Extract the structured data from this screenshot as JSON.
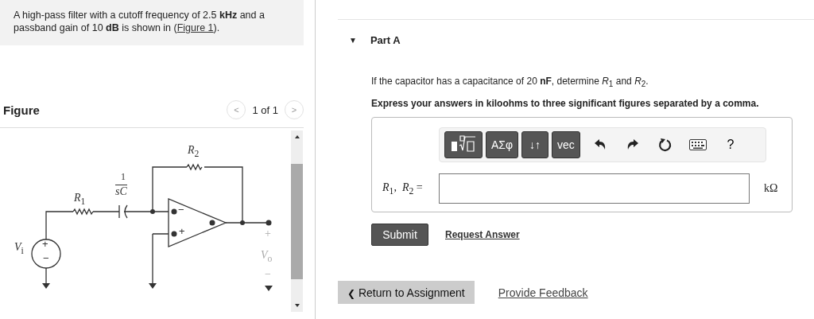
{
  "problem": {
    "text": "A high-pass filter with a cutoff frequency of 2.5 **kHz** and a passband gain of 10 **dB** is shown in (",
    "link": "Figure 1",
    "after": ")."
  },
  "figure": {
    "heading": "Figure",
    "pager": "1 of 1",
    "prev": "<",
    "next": ">",
    "labels": [
      {
        "kind": "r2",
        "text": "*R*$_{2}$"
      },
      {
        "kind": "r1",
        "text": "*R*$_{1}$"
      },
      {
        "kind": "cap_num",
        "text": "1"
      },
      {
        "kind": "cap_den",
        "text": "*sC*"
      },
      {
        "kind": "vi",
        "text": "*V*$_{i}$"
      },
      {
        "kind": "src_plus",
        "text": "+"
      },
      {
        "kind": "src_minus",
        "text": "−"
      },
      {
        "kind": "inv",
        "text": "−"
      },
      {
        "kind": "noninv",
        "text": "+"
      },
      {
        "kind": "vo_plus",
        "text": "+"
      },
      {
        "kind": "vo",
        "text": "*V*$_{o}$"
      },
      {
        "kind": "vo_minus",
        "text": "−"
      }
    ]
  },
  "part": {
    "toggle": "▼",
    "title": "Part A",
    "expanded": true,
    "question": "If the capacitor has a capacitance of 20 **nF**, determine *R*$_{1}$ and *R*$_{2}$.",
    "instruction": "Express your answers in kiloohms to three significant figures separated by a comma.",
    "toolbar": [
      {
        "kind": "template"
      },
      {
        "kind": "text",
        "label": "ΑΣφ"
      },
      {
        "kind": "text",
        "label": "↓↑"
      },
      {
        "kind": "text",
        "label": "vec"
      },
      {
        "kind": "undo"
      },
      {
        "kind": "redo"
      },
      {
        "kind": "reset"
      },
      {
        "kind": "keyboard"
      },
      {
        "kind": "help",
        "label": "?"
      }
    ],
    "answer_label": "*R*$_{1}$,  *R*$_{2}$ =",
    "unit": "kΩ",
    "submit": "Submit",
    "request": "Request Answer"
  },
  "footer": {
    "back_arrow": "❮",
    "back": "Return to Assignment",
    "feedback": "Provide Feedback"
  }
}
